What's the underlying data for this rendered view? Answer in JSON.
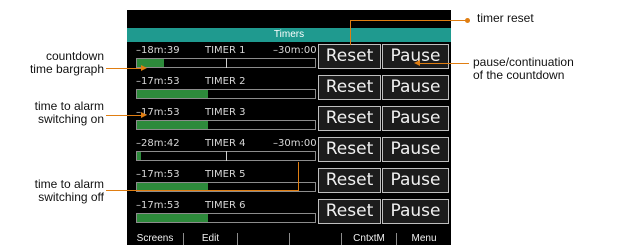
{
  "screen": {
    "title": "Timers",
    "timers": [
      {
        "left": "–18m:39",
        "name": "TIMER 1",
        "right": "–30m:00",
        "progress": 0.15,
        "marker": 0.5
      },
      {
        "left": "–17m:53",
        "name": "TIMER 2",
        "right": "",
        "progress": 0.4,
        "marker": null
      },
      {
        "left": "–17m:53",
        "name": "TIMER 3",
        "right": "",
        "progress": 0.4,
        "marker": null
      },
      {
        "left": "–28m:42",
        "name": "TIMER 4",
        "right": "–30m:00",
        "progress": 0.02,
        "marker": 0.5
      },
      {
        "left": "–17m:53",
        "name": "TIMER 5",
        "right": "",
        "progress": 0.4,
        "marker": null
      },
      {
        "left": "–17m:53",
        "name": "TIMER 6",
        "right": "",
        "progress": 0.4,
        "marker": null
      }
    ],
    "reset_label": "Reset",
    "pause_label": "Pause",
    "softkeys": [
      "Screens",
      "Edit",
      "",
      "",
      "CntxtM",
      "Menu"
    ]
  },
  "callouts": {
    "bargraph": "countdown\ntime bargraph",
    "alarm_on": "time to alarm\nswitching on",
    "alarm_off": "time to alarm\nswitching off",
    "reset": "timer reset",
    "pause": "pause/continuation\nof the countdown"
  },
  "colors": {
    "title_bar": "#1f9a8f",
    "bar_fill": "#2d8a3b",
    "callout_line": "#e07e12"
  }
}
